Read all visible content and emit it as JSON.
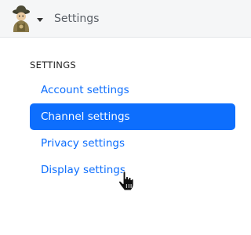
{
  "header": {
    "title": "Settings",
    "avatar_icon": "user-avatar-icon",
    "dropdown_icon": "caret-down-icon"
  },
  "sidebar": {
    "heading": "SETTINGS",
    "items": [
      {
        "label": "Account settings",
        "active": false
      },
      {
        "label": "Channel settings",
        "active": true
      },
      {
        "label": "Privacy settings",
        "active": false
      },
      {
        "label": "Display settings",
        "active": false
      }
    ]
  },
  "colors": {
    "accent": "#0d6efd",
    "link": "#0d6efd",
    "topbar_bg": "#f5f6f7"
  },
  "cursor": {
    "icon": "hand-pointer-icon"
  }
}
